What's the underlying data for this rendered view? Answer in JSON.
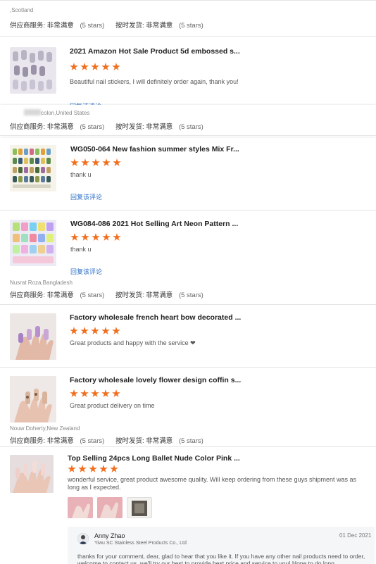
{
  "block1": {
    "location": ",Scotland",
    "supplier_service_label": "供应商服务:",
    "supplier_service_value": "非常满意",
    "supplier_service_stars": "(5 stars)",
    "ontime_label": "按时发货:",
    "ontime_value": "非常满意",
    "ontime_stars": "(5 stars)",
    "product_title": "2021 Amazon Hot Sale Product 5d embossed s...",
    "rating": 5,
    "comment": "Beautiful nail stickers, I will definitely order again, thank you!",
    "reply_link": "回复该评论"
  },
  "block2": {
    "location": "colon,United States",
    "supplier_service_label": "供应商服务:",
    "supplier_service_value": "非常满意",
    "supplier_service_stars": "(5 stars)",
    "ontime_label": "按时发货:",
    "ontime_value": "非常满意",
    "ontime_stars": "(5 stars)",
    "items": [
      {
        "title": "WG050-064 New fashion summer styles Mix Fr...",
        "rating": 5,
        "comment": "thank u",
        "reply_link": "回复该评论"
      },
      {
        "title": "WG084-086 2021 Hot Selling Art Neon Pattern ...",
        "rating": 5,
        "comment": "thank u",
        "reply_link": "回复该评论"
      }
    ]
  },
  "block3": {
    "location": "Nusrat Roza,Bangladesh",
    "supplier_service_label": "供应商服务:",
    "supplier_service_value": "非常满意",
    "supplier_service_stars": "(5 stars)",
    "ontime_label": "按时发货:",
    "ontime_value": "非常满意",
    "ontime_stars": "(5 stars)",
    "items": [
      {
        "title": "Factory wholesale french heart bow decorated ...",
        "rating": 5,
        "comment": "Great products and happy with the service ❤"
      },
      {
        "title": "Factory wholesale lovely flower design coffin s...",
        "rating": 5,
        "comment": "Great product delivery on time"
      }
    ]
  },
  "block4": {
    "location": "Nouw Doherty,New Zealand",
    "supplier_service_label": "供应商服务:",
    "supplier_service_value": "非常满意",
    "supplier_service_stars": "(5 stars)",
    "ontime_label": "按时发货:",
    "ontime_value": "非常满意",
    "ontime_stars": "(5 stars)",
    "product_title": "Top Selling 24pcs Long Ballet Nude Color Pink ...",
    "rating": 5,
    "comment": "wonderful service, great product awesome quality. Will keep ordering from these guys shipment was as long as I expected.",
    "reply": {
      "name": "Anny Zhao",
      "company": "Yiwu SC Stainless Steel Products Co., Ltd",
      "date": "01 Dec 2021",
      "text": "thanks for your comment, dear, glad to hear that you like it. If you have any other nail products need to order, welcome to contact us, we'll try our best to provide best price and service to you!  Hope to do long"
    }
  },
  "colors": {
    "star": "#f26d1c",
    "link": "#2c6fc5",
    "divider": "#e5e5e5"
  }
}
